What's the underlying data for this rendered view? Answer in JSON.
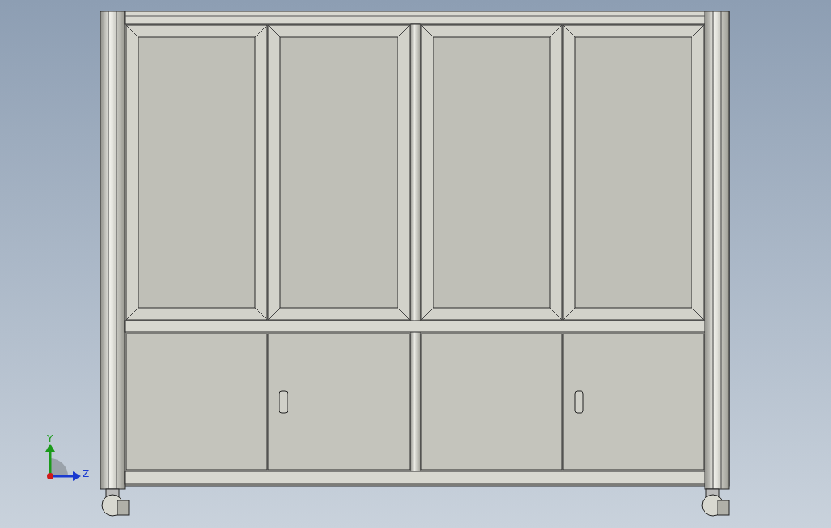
{
  "viewport": {
    "axis_labels": [
      {
        "kind": "vertical",
        "text": "Y"
      },
      {
        "kind": "horizontal",
        "text": "Z"
      }
    ]
  }
}
